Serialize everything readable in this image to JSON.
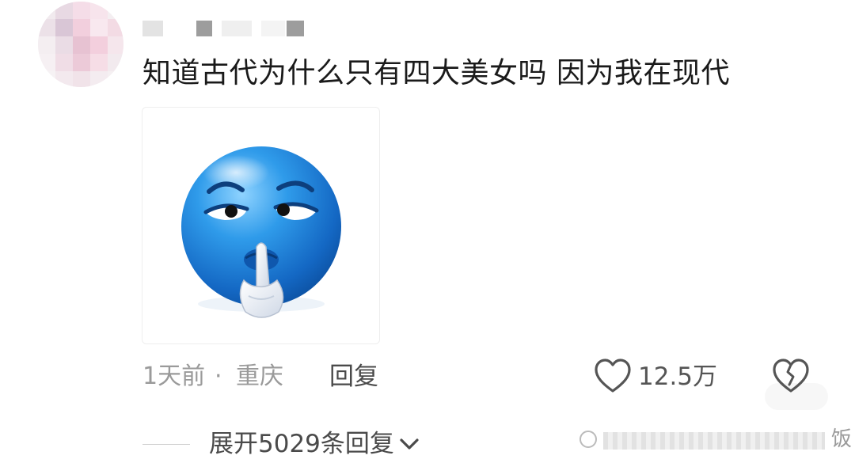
{
  "comment": {
    "text": "知道古代为什么只有四大美女吗 因为我在现代",
    "time": "1天前",
    "separator": "·",
    "location": "重庆",
    "reply_label": "回复",
    "like_count": "12.5万",
    "expand_label": "展开5029条回复"
  },
  "image": {
    "emoji": "blue-shush-face"
  },
  "watermark": {
    "char": "饭"
  },
  "colors": {
    "text": "#1a1a1a",
    "meta": "#9a9a9a",
    "emoji_blue": "#1e7fd6"
  }
}
